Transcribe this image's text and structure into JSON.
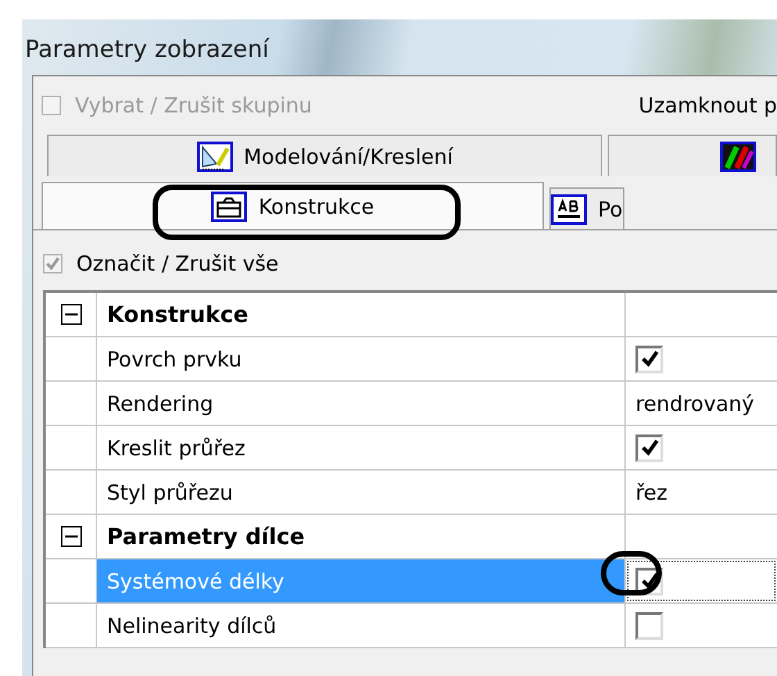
{
  "window": {
    "title": "Parametry zobrazení"
  },
  "group_toggle": {
    "label": "Vybrat / Zrušit skupinu",
    "checked": false,
    "disabled": true
  },
  "lock_label": "Uzamknout p",
  "tab_rows": [
    {
      "tabs": [
        {
          "label": "Modelování/Kreslení",
          "selected": false,
          "highlighted": false
        },
        {
          "selected": false,
          "highlighted": false
        }
      ]
    },
    {
      "tabs": [
        {
          "label": "Konstrukce",
          "selected": true,
          "highlighted": true
        },
        {
          "label": "Po",
          "selected": false,
          "highlighted": false
        }
      ]
    }
  ],
  "check_all": {
    "label": "Označit / Zrušit vše",
    "checked": true,
    "disabled": true
  },
  "groups": [
    {
      "label": "Konstrukce",
      "expanded": true,
      "children": [
        {
          "label": "Povrch prvku",
          "kind": "checkbox",
          "checked": true,
          "selected": false,
          "highlighted": false
        },
        {
          "label": "Rendering",
          "kind": "text",
          "value": "rendrovaný",
          "selected": false,
          "highlighted": false
        },
        {
          "label": "Kreslit průřez",
          "kind": "checkbox",
          "checked": true,
          "selected": false,
          "highlighted": false
        },
        {
          "label": "Styl průřezu",
          "kind": "text",
          "value": "řez",
          "selected": false,
          "highlighted": false
        }
      ]
    },
    {
      "label": "Parametry dílce",
      "expanded": true,
      "children": [
        {
          "label": "Systémové délky",
          "kind": "checkbox",
          "checked": true,
          "selected": true,
          "highlighted": true
        },
        {
          "label": "Nelinearity dílců",
          "kind": "checkbox",
          "checked": false,
          "selected": false,
          "highlighted": false
        }
      ]
    }
  ]
}
